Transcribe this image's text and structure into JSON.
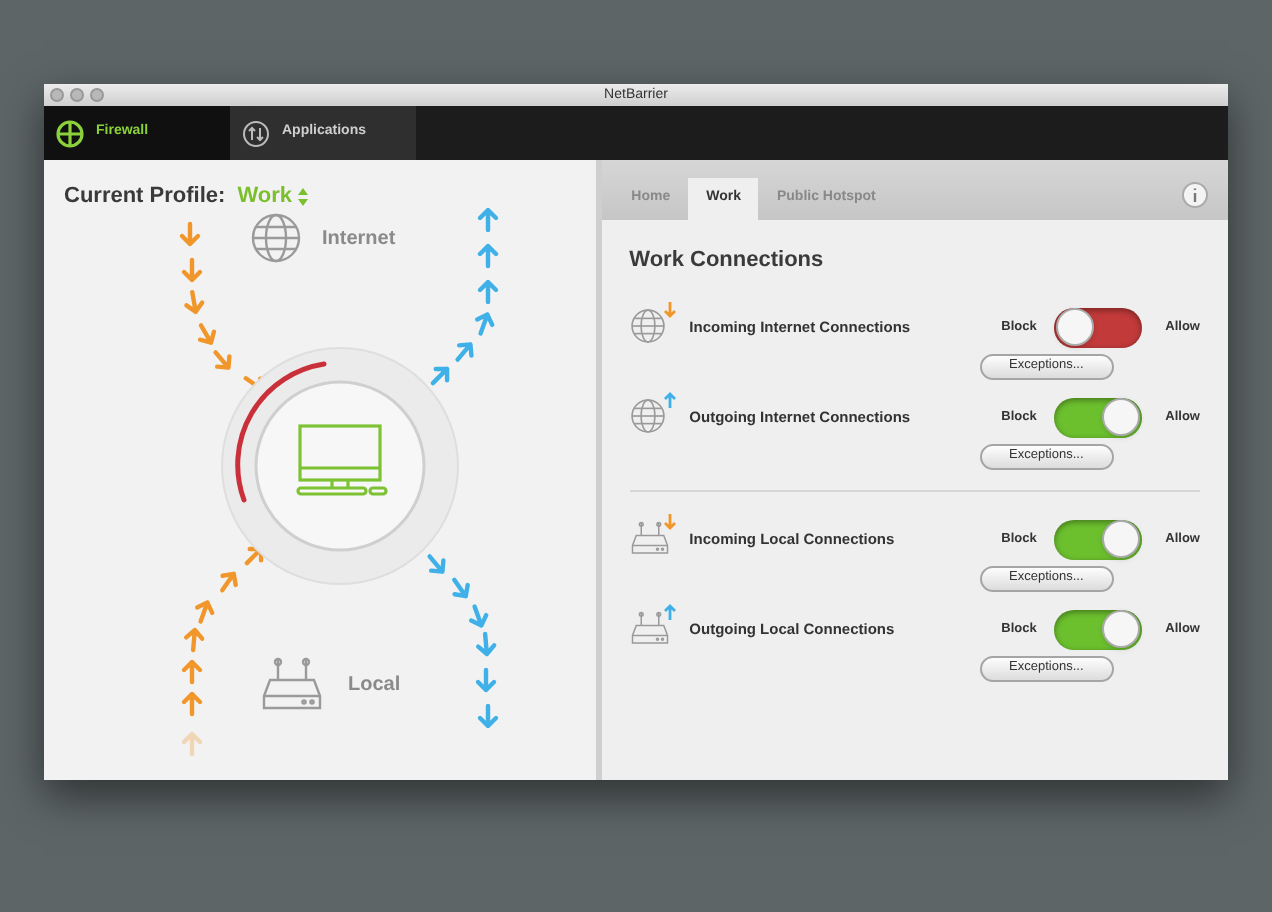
{
  "window": {
    "title": "NetBarrier"
  },
  "main_tabs": [
    {
      "label": "Firewall",
      "selected": true
    },
    {
      "label": "Applications",
      "selected": false
    }
  ],
  "profile": {
    "label": "Current Profile:",
    "value": "Work"
  },
  "diagram": {
    "internet_label": "Internet",
    "local_label": "Local",
    "blocked_arc": true
  },
  "profile_tabs": [
    {
      "label": "Home",
      "selected": false
    },
    {
      "label": "Work",
      "selected": true
    },
    {
      "label": "Public Hotspot",
      "selected": false
    }
  ],
  "section_title": "Work Connections",
  "groups": [
    {
      "connections": [
        {
          "kind": "internet",
          "incoming": true,
          "label": "Incoming Internet Connections",
          "block_label": "Block",
          "allow_label": "Allow",
          "on": false,
          "button": "Exceptions..."
        },
        {
          "kind": "internet",
          "incoming": false,
          "label": "Outgoing Internet Connections",
          "block_label": "Block",
          "allow_label": "Allow",
          "on": true,
          "button": "Exceptions..."
        }
      ]
    },
    {
      "connections": [
        {
          "kind": "local",
          "incoming": true,
          "label": "Incoming Local Connections",
          "block_label": "Block",
          "allow_label": "Allow",
          "on": true,
          "button": "Exceptions..."
        },
        {
          "kind": "local",
          "incoming": false,
          "label": "Outgoing Local Connections",
          "block_label": "Block",
          "allow_label": "Allow",
          "on": true,
          "button": "Exceptions..."
        }
      ]
    }
  ]
}
